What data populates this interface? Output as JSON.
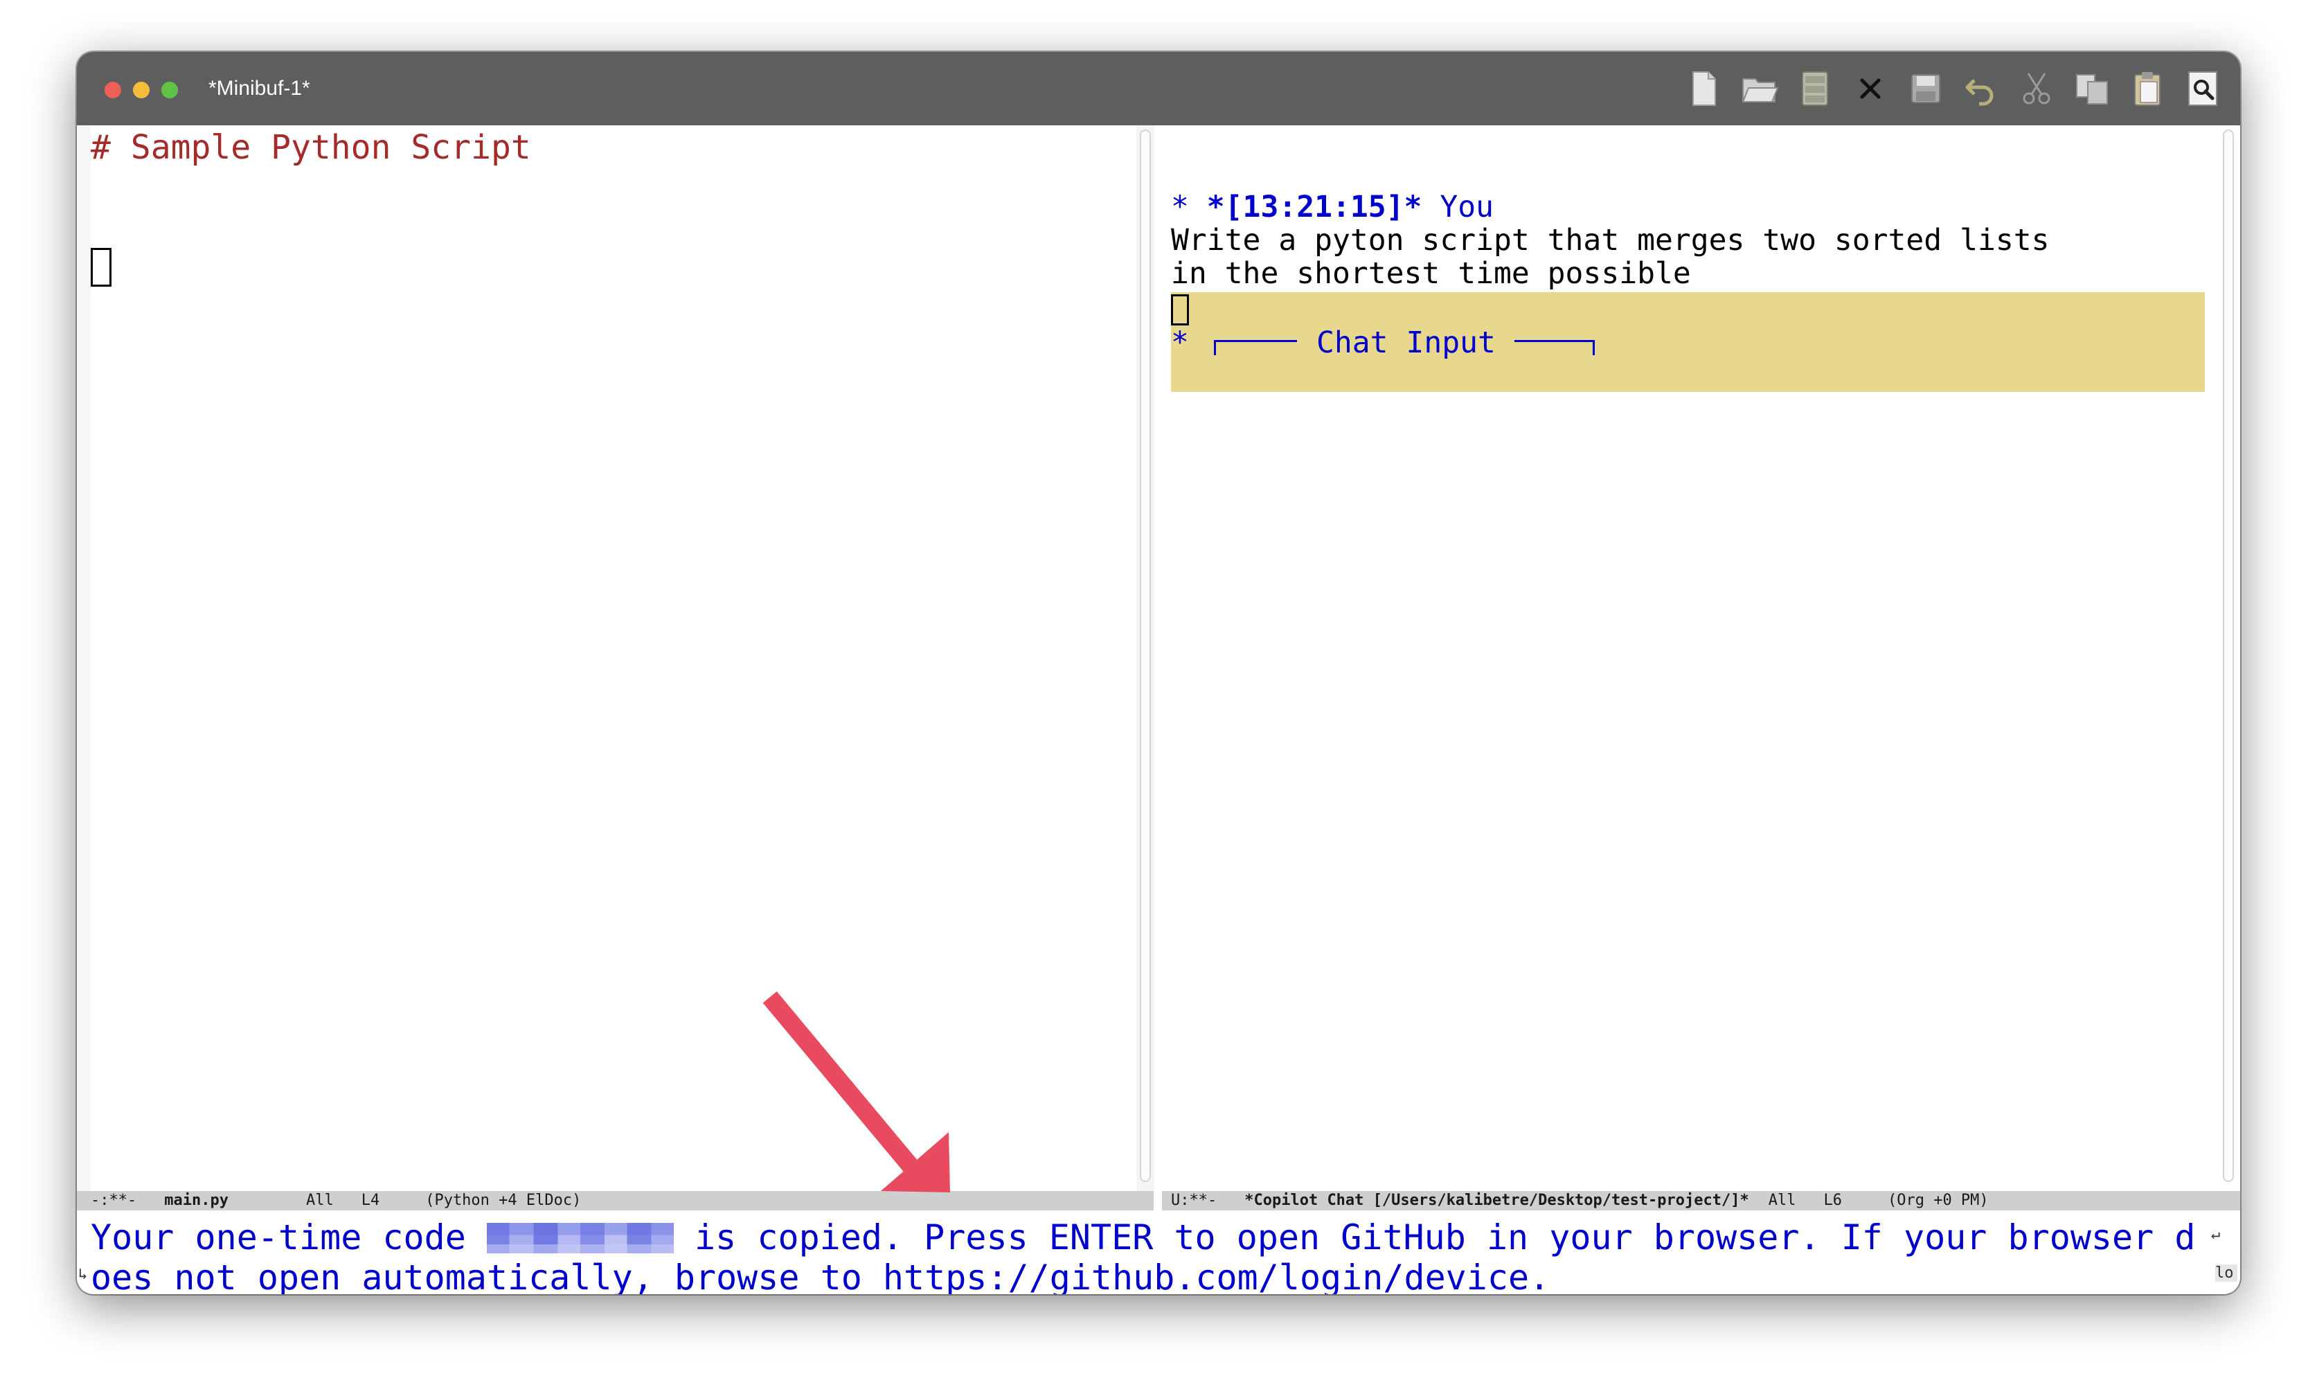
{
  "window": {
    "title": "*Minibuf-1*"
  },
  "toolbar": {
    "icons": [
      "new-file-icon",
      "open-folder-icon",
      "dired-icon",
      "close-icon",
      "save-icon",
      "undo-icon",
      "cut-icon",
      "copy-icon",
      "paste-icon",
      "search-icon"
    ]
  },
  "editor": {
    "line1": "# Sample Python Script"
  },
  "chat": {
    "header_prefix": "* ",
    "header_time": "*[13:21:15]*",
    "header_user": " You",
    "message_line1": "Write a pyton script that merges two sorted lists",
    "message_line2": "in the shortest time possible",
    "input_star": "*",
    "input_label": "Chat Input"
  },
  "modeline_left": {
    "status": "-:**-",
    "buffer": "main.py",
    "position": "All",
    "line": "L4",
    "modes": "(Python +4 ElDoc)"
  },
  "modeline_right": {
    "status": "U:**-",
    "buffer": "*Copilot Chat [/Users/kalibetre/Desktop/test-project/]*",
    "position": "All",
    "line": "L6",
    "modes": "(Org +0 PM)"
  },
  "echo": {
    "part1": "Your one-time code ",
    "part2": " is copied. Press ENTER to open GitHub in your browser. If your browser d",
    "line2": "oes not open automatically, browse to https://github.com/login/device."
  },
  "colors": {
    "accent_blue": "#0000cd",
    "comment_red": "#a52a2a",
    "chat_input_bg": "#e8d88d",
    "arrow": "#e84a5f"
  }
}
